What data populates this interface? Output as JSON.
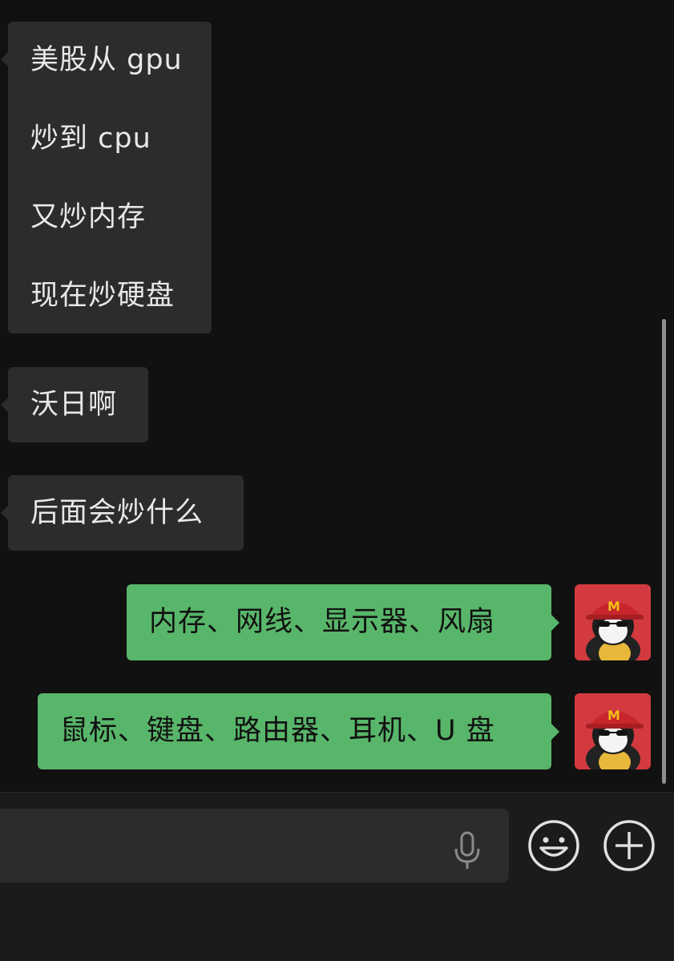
{
  "messages": [
    {
      "side": "in",
      "lines": [
        "美股从 gpu",
        "炒到 cpu",
        "又炒内存",
        "现在炒硬盘"
      ]
    },
    {
      "side": "in",
      "lines": [
        "沃日啊"
      ]
    },
    {
      "side": "in",
      "lines": [
        "后面会炒什么"
      ]
    },
    {
      "side": "out",
      "lines": [
        "内存、网线、显示器、风扇"
      ]
    },
    {
      "side": "out",
      "lines": [
        "鼠标、键盘、路由器、耳机、U 盘"
      ]
    }
  ],
  "avatar": {
    "icon": "penguin-mcdonalds-cap-avatar",
    "cap_letter": "M",
    "bg_color": "#d23a3f"
  },
  "input_bar": {
    "voice_icon": "microphone-icon",
    "emoji_icon": "smiley-face-icon",
    "more_icon": "plus-circle-icon"
  },
  "colors": {
    "background": "#111111",
    "incoming": "#2c2c2c",
    "outgoing": "#58b66a"
  }
}
